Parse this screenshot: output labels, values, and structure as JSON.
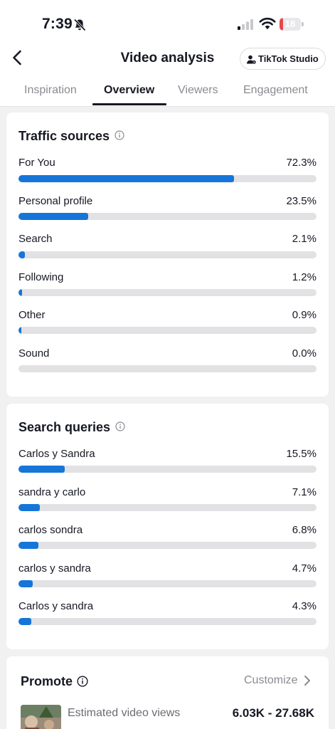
{
  "status_bar": {
    "time": "7:39",
    "battery_level": "18",
    "battery_fraction": 0.18,
    "signal_bars_active": 1,
    "colors": {
      "battery_low": "#e5484d"
    }
  },
  "header": {
    "title": "Video analysis",
    "studio_button_label": "TikTok Studio",
    "tabs": [
      {
        "label": "Inspiration",
        "active": false
      },
      {
        "label": "Overview",
        "active": true
      },
      {
        "label": "Viewers",
        "active": false
      },
      {
        "label": "Engagement",
        "active": false
      }
    ]
  },
  "traffic_sources": {
    "title": "Traffic sources",
    "items": [
      {
        "label": "For You",
        "value": "72.3%",
        "fraction": 0.723
      },
      {
        "label": "Personal profile",
        "value": "23.5%",
        "fraction": 0.235
      },
      {
        "label": "Search",
        "value": "2.1%",
        "fraction": 0.021
      },
      {
        "label": "Following",
        "value": "1.2%",
        "fraction": 0.012
      },
      {
        "label": "Other",
        "value": "0.9%",
        "fraction": 0.009
      },
      {
        "label": "Sound",
        "value": "0.0%",
        "fraction": 0.0
      }
    ]
  },
  "search_queries": {
    "title": "Search queries",
    "items": [
      {
        "label": "Carlos y Sandra",
        "value": "15.5%",
        "fraction": 0.155
      },
      {
        "label": "sandra y carlo",
        "value": "7.1%",
        "fraction": 0.071
      },
      {
        "label": "carlos sondra",
        "value": "6.8%",
        "fraction": 0.068
      },
      {
        "label": "carlos y sandra",
        "value": "4.7%",
        "fraction": 0.047
      },
      {
        "label": "Carlos y sandra",
        "value": "4.3%",
        "fraction": 0.043
      }
    ]
  },
  "promote": {
    "title": "Promote",
    "customize_label": "Customize",
    "estimated_label": "Estimated video views",
    "estimated_value": "6.03K - 27.68K"
  },
  "colors": {
    "bar_fill": "#1675d8",
    "bar_track": "#e2e2e4",
    "text_primary": "#161823",
    "text_secondary": "#8a8b91"
  },
  "icons": [
    "bell-slash-icon",
    "signal-icon",
    "wifi-icon",
    "battery-icon",
    "back-arrow-icon",
    "person-icon",
    "info-icon",
    "chevron-right-icon"
  ]
}
